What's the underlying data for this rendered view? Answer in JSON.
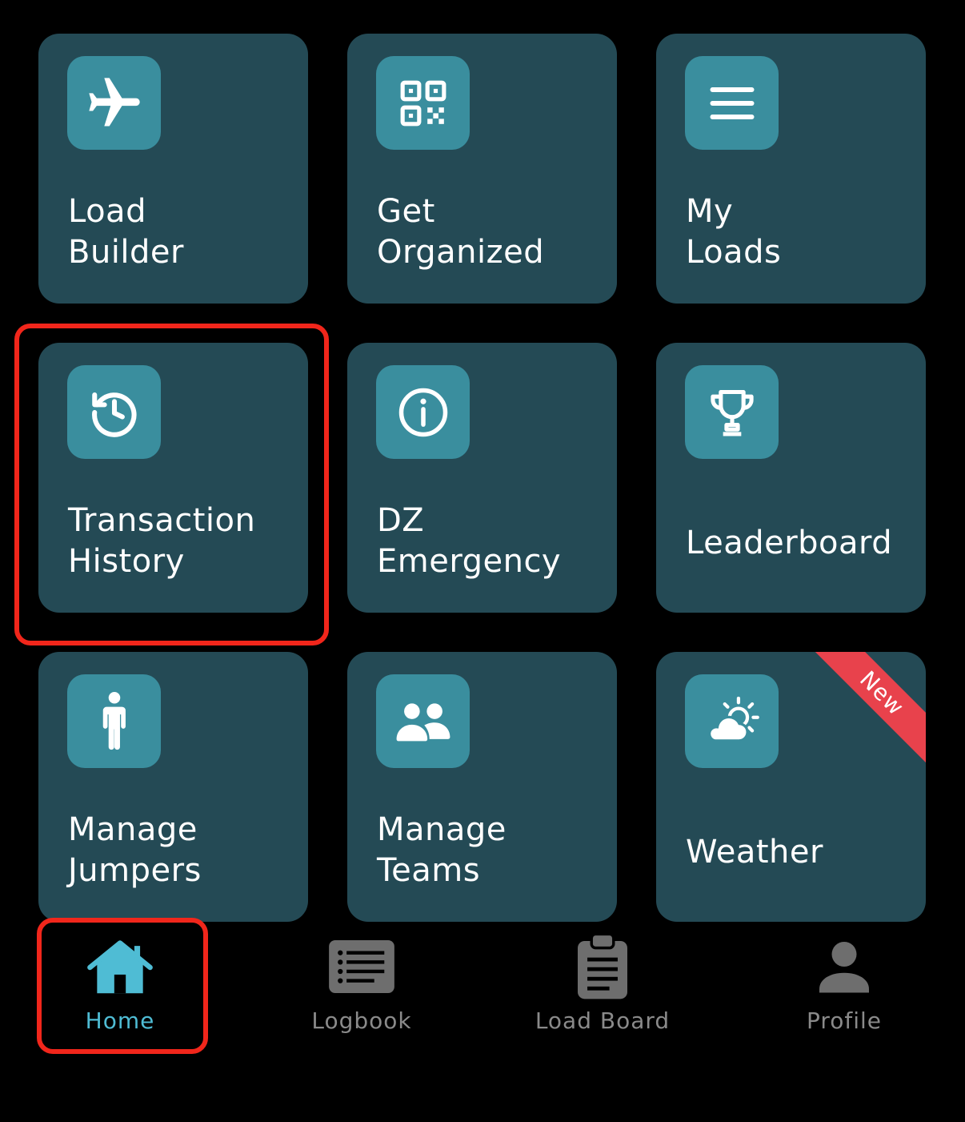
{
  "tiles": [
    {
      "id": "load-builder",
      "label": "Load\nBuilder",
      "icon": "airplane-icon"
    },
    {
      "id": "get-organized",
      "label": "Get\nOrganized",
      "icon": "qr-code-icon"
    },
    {
      "id": "my-loads",
      "label": "My\nLoads",
      "icon": "menu-lines-icon"
    },
    {
      "id": "transaction-history",
      "label": "Transaction\nHistory",
      "icon": "history-clock-icon"
    },
    {
      "id": "dz-emergency",
      "label": "DZ\nEmergency",
      "icon": "info-circle-icon"
    },
    {
      "id": "leaderboard",
      "label": "Leaderboard",
      "icon": "trophy-icon"
    },
    {
      "id": "manage-jumpers",
      "label": "Manage\nJumpers",
      "icon": "person-icon"
    },
    {
      "id": "manage-teams",
      "label": "Manage\nTeams",
      "icon": "people-icon"
    },
    {
      "id": "weather",
      "label": "Weather",
      "icon": "partly-cloudy-icon",
      "badge": "New"
    }
  ],
  "tabs": [
    {
      "id": "home",
      "label": "Home",
      "icon": "home-icon",
      "active": true
    },
    {
      "id": "logbook",
      "label": "Logbook",
      "icon": "list-icon",
      "active": false
    },
    {
      "id": "load-board",
      "label": "Load Board",
      "icon": "clipboard-icon",
      "active": false
    },
    {
      "id": "profile",
      "label": "Profile",
      "icon": "user-icon",
      "active": false
    }
  ],
  "colors": {
    "background": "#000000",
    "tile": "#244a55",
    "icon_box": "#3a8e9e",
    "ribbon": "#e8424c",
    "highlight": "#f1261b",
    "tab_active": "#4fbcd4",
    "tab_inactive": "#8a8a8a"
  }
}
